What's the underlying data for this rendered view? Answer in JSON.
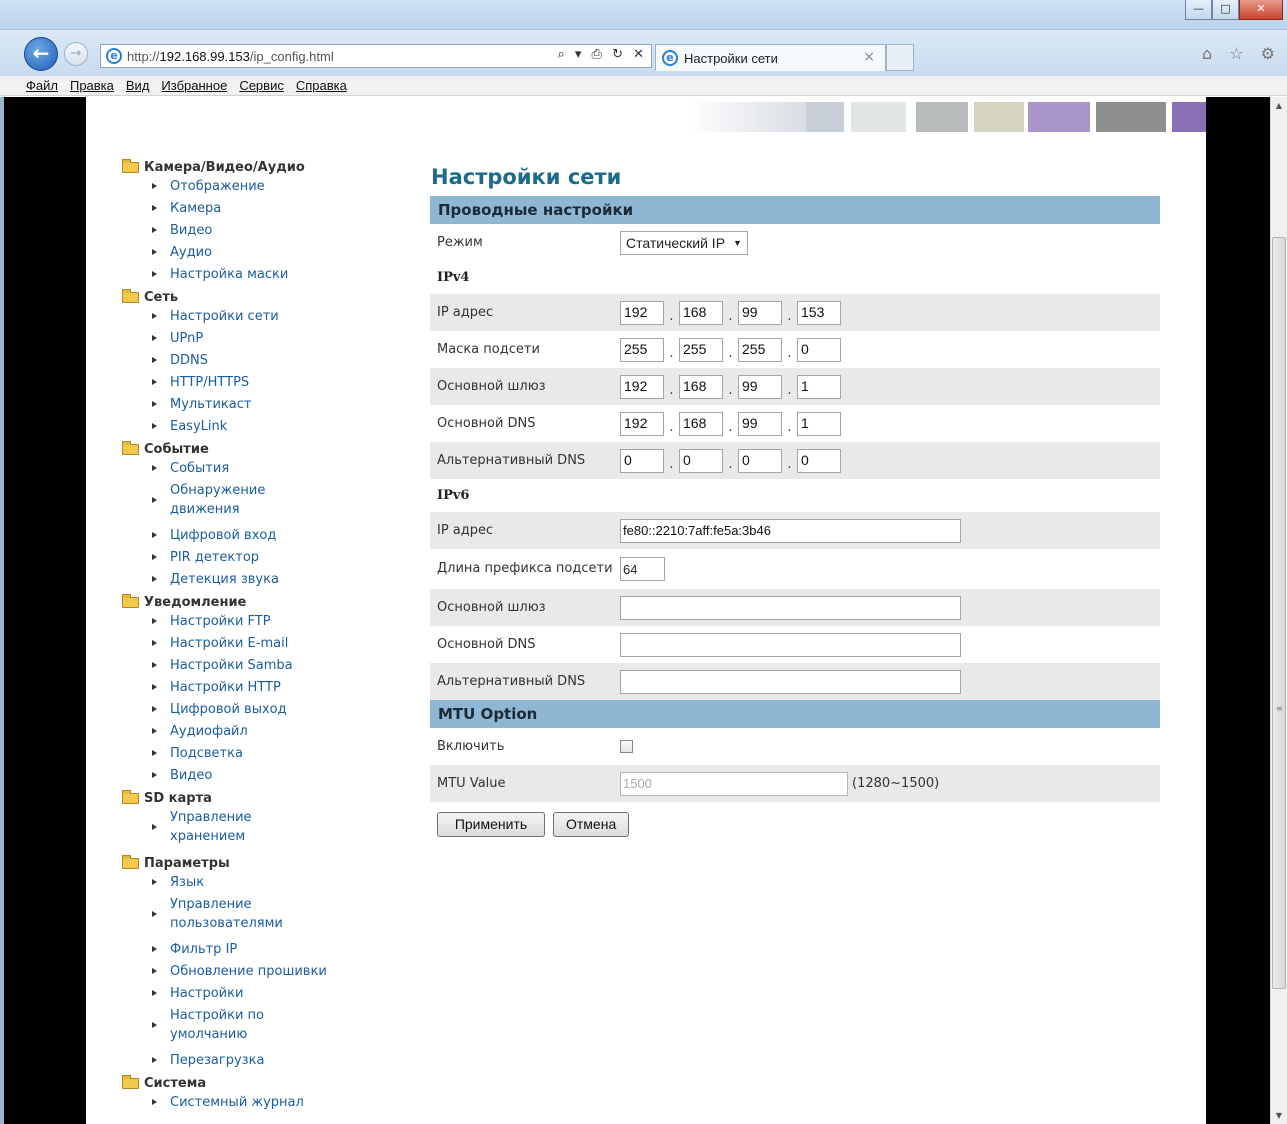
{
  "browser": {
    "url_prefix": "http://",
    "url_host": "192.168.99.153",
    "url_path": "/ip_config.html",
    "addr_tools": "⌕ ▾ ⎙ ↻ ✕",
    "tab_title": "Настройки сети",
    "tab_close": "×",
    "ie_icon": "e",
    "back_icon": "←",
    "forward_icon": "→",
    "right_icons": "⌂ ☆ ⚙",
    "window_buttons": [
      "—",
      "□",
      "✕"
    ]
  },
  "menu": [
    "Файл",
    "Правка",
    "Вид",
    "Избранное",
    "Сервис",
    "Справка"
  ],
  "sidebar": [
    {
      "title": "Камера/Видео/Аудио",
      "items": [
        "Отображение",
        "Камера",
        "Видео",
        "Аудио",
        "Настройка маски"
      ]
    },
    {
      "title": "Сеть",
      "items": [
        "Настройки сети",
        "UPnP",
        "DDNS",
        "HTTP/HTTPS",
        "Мультикаст",
        "EasyLink"
      ]
    },
    {
      "title": "Событие",
      "items": [
        "События",
        "Обнаружение движения",
        "Цифровой вход",
        "PIR детектор",
        "Детекция звука"
      ]
    },
    {
      "title": "Уведомление",
      "items": [
        "Настройки FTP",
        "Настройки E-mail",
        "Настройки Samba",
        "Настройки HTTP",
        "Цифровой выход",
        "Аудиофайл",
        "Подсветка",
        "Видео"
      ]
    },
    {
      "title": "SD карта",
      "items": [
        "Управление хранением"
      ]
    },
    {
      "title": "Параметры",
      "items": [
        "Язык",
        "Управление пользователями",
        "Фильтр IP",
        "Обновление прошивки",
        "Настройки",
        "Настройки по умолчанию",
        "Перезагрузка"
      ]
    },
    {
      "title": "Система",
      "items": [
        "Системный журнал"
      ]
    }
  ],
  "content": {
    "title": "Настройки сети",
    "wired_header": "Проводные настройки",
    "mode_label": "Режим",
    "mode_value": "Статический IP",
    "ipv4_header": "IPv4",
    "ipv4": [
      {
        "label": "IP адрес",
        "octets": [
          "192",
          "168",
          "99",
          "153"
        ]
      },
      {
        "label": "Маска подсети",
        "octets": [
          "255",
          "255",
          "255",
          "0"
        ]
      },
      {
        "label": "Основной шлюз",
        "octets": [
          "192",
          "168",
          "99",
          "1"
        ]
      },
      {
        "label": "Основной DNS",
        "octets": [
          "192",
          "168",
          "99",
          "1"
        ]
      },
      {
        "label": "Альтернативный DNS",
        "octets": [
          "0",
          "0",
          "0",
          "0"
        ]
      }
    ],
    "ipv6_header": "IPv6",
    "ipv6_ip_label": "IP адрес",
    "ipv6_ip_value": "fe80::2210:7aff:fe5a:3b46",
    "ipv6_prefix_label": "Длина префикса подсети",
    "ipv6_prefix_value": "64",
    "ipv6_gateway_label": "Основной шлюз",
    "ipv6_gateway_value": "",
    "ipv6_dns_label": "Основной DNS",
    "ipv6_dns_value": "",
    "ipv6_altdns_label": "Альтернативный DNS",
    "ipv6_altdns_value": "",
    "mtu_header": "MTU Option",
    "mtu_enable_label": "Включить",
    "mtu_enabled": false,
    "mtu_value_label": "MTU Value",
    "mtu_value": "1500",
    "mtu_range": "(1280~1500)",
    "apply_label": "Применить",
    "cancel_label": "Отмена"
  },
  "colors": {
    "section_header_bg": "#8fb7d4",
    "title_color": "#1c6a8c",
    "link_color": "#1a5c9e",
    "alt_row_bg": "#e9e9e9"
  }
}
